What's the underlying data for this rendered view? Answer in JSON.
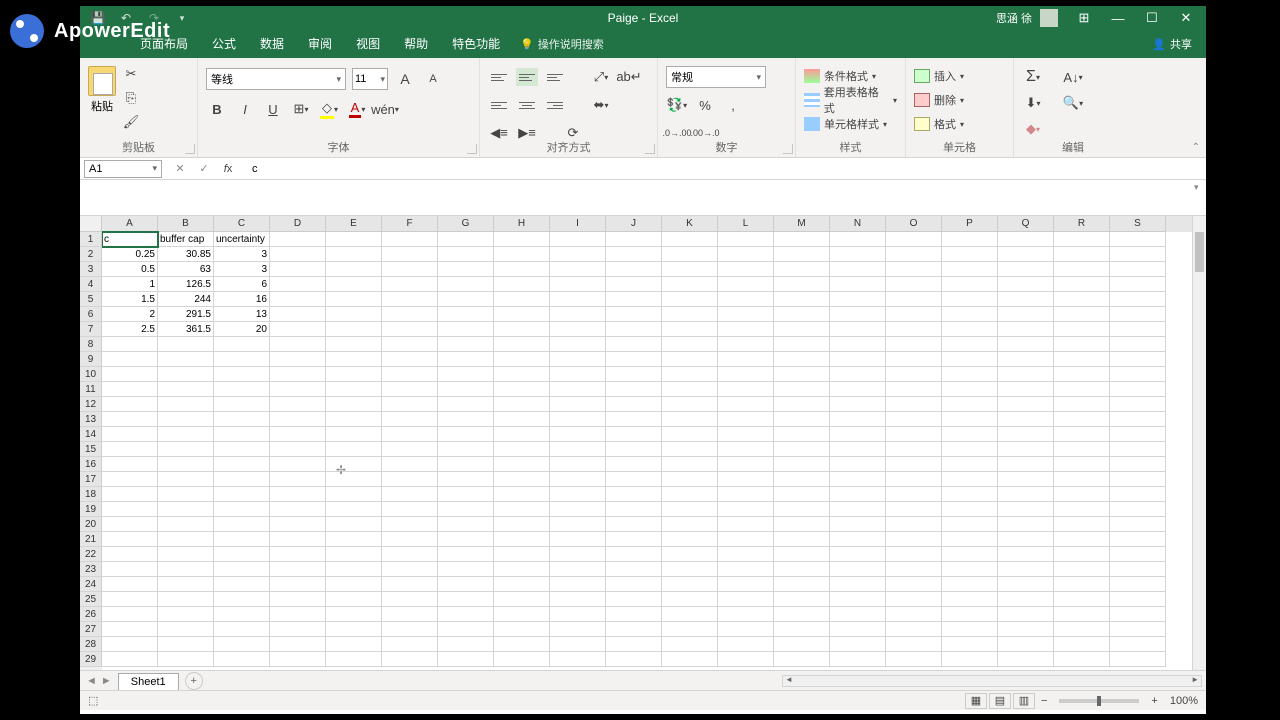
{
  "watermark": "ApowerEdit",
  "titlebar": {
    "title": "Paige - Excel",
    "user": "思涵 徐"
  },
  "menutabs": [
    "页面布局",
    "公式",
    "数据",
    "审阅",
    "视图",
    "帮助",
    "特色功能"
  ],
  "tellme": "操作说明搜索",
  "share": "共享",
  "ribbon": {
    "clipboard": {
      "paste": "粘贴",
      "label": "剪贴板"
    },
    "font": {
      "name": "等线",
      "size": "11",
      "label": "字体"
    },
    "align": {
      "label": "对齐方式"
    },
    "number": {
      "format": "常规",
      "label": "数字"
    },
    "styles": {
      "cond": "条件格式",
      "table": "套用表格格式",
      "cell": "单元格样式",
      "label": "样式"
    },
    "cells": {
      "insert": "插入",
      "delete": "删除",
      "format": "格式",
      "label": "单元格"
    },
    "editing": {
      "label": "编辑"
    }
  },
  "namebox": "A1",
  "formula": "c",
  "columns": [
    "A",
    "B",
    "C",
    "D",
    "E",
    "F",
    "G",
    "H",
    "I",
    "J",
    "K",
    "L",
    "M",
    "N",
    "O",
    "P",
    "Q",
    "R",
    "S"
  ],
  "rows": [
    "1",
    "2",
    "3",
    "4",
    "5",
    "6",
    "7",
    "8",
    "9",
    "10",
    "11",
    "12",
    "13",
    "14",
    "15",
    "16",
    "17",
    "18",
    "19",
    "20",
    "21",
    "22",
    "23",
    "24",
    "25",
    "26",
    "27",
    "28",
    "29"
  ],
  "data": {
    "headers": [
      "c",
      "buffer cap",
      "uncertainty"
    ],
    "r2": [
      "0.25",
      "30.85",
      "3"
    ],
    "r3": [
      "0.5",
      "63",
      "3"
    ],
    "r4": [
      "1",
      "126.5",
      "6"
    ],
    "r5": [
      "1.5",
      "244",
      "16"
    ],
    "r6": [
      "2",
      "291.5",
      "13"
    ],
    "r7": [
      "2.5",
      "361.5",
      "20"
    ]
  },
  "sheet": "Sheet1",
  "zoom": "100%"
}
